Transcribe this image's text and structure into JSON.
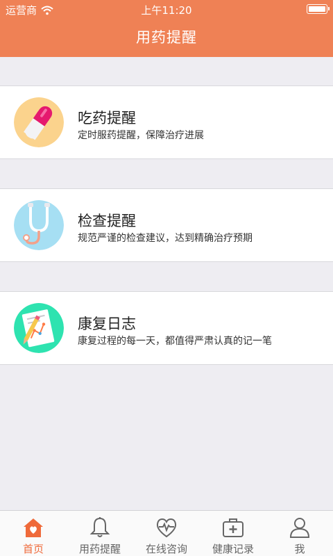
{
  "status_bar": {
    "carrier": "运营商",
    "time": "上午11:20"
  },
  "header": {
    "title": "用药提醒"
  },
  "cards": [
    {
      "title": "吃药提醒",
      "desc": "定时服药提醒，保障治疗进展",
      "icon": "pill-icon"
    },
    {
      "title": "检查提醒",
      "desc": "规范严谨的检查建议，达到精确治疗预期",
      "icon": "stethoscope-icon"
    },
    {
      "title": "康复日志",
      "desc": "康复过程的每一天，都值得严肃认真的记一笔",
      "icon": "chart-document-icon"
    }
  ],
  "tabbar": {
    "active": "首页",
    "items": [
      {
        "label": "首页",
        "icon": "home-icon"
      },
      {
        "label": "用药提醒",
        "icon": "bell-icon"
      },
      {
        "label": "在线咨询",
        "icon": "heart-consult-icon"
      },
      {
        "label": "健康记录",
        "icon": "medical-kit-icon"
      },
      {
        "label": "我",
        "icon": "user-icon"
      }
    ]
  },
  "colors": {
    "brand": "#ef8155",
    "active_tab": "#ef6a3a",
    "background": "#eeedf2"
  }
}
